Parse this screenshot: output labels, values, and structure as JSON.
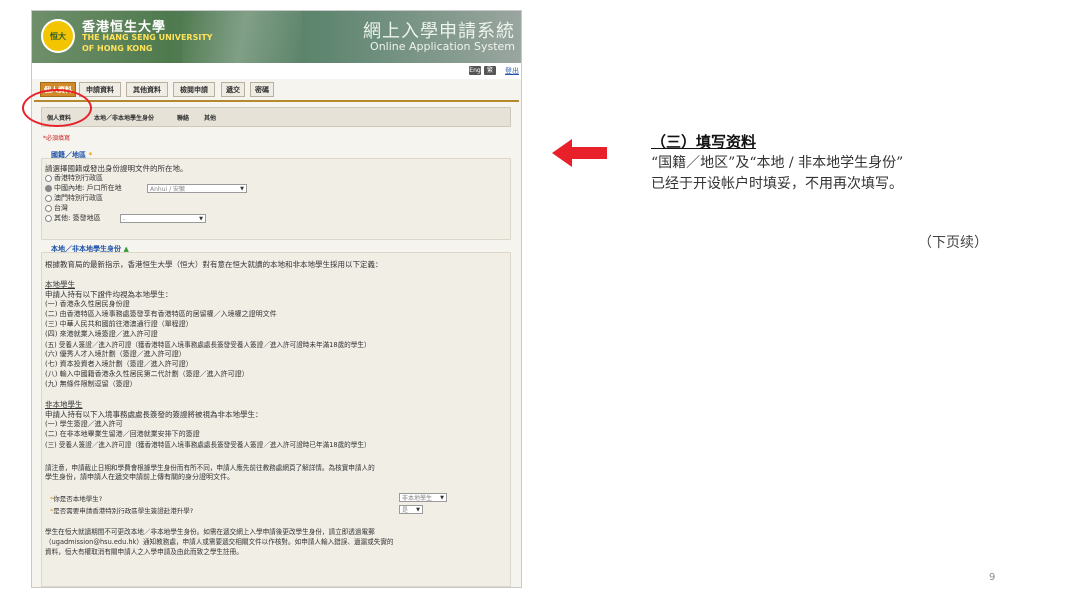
{
  "header": {
    "logo_text": "恒大",
    "university_zh": "香港恒生大學",
    "university_en_line1": "THE HANG SENG UNIVERSITY",
    "university_en_line2": "OF HONG KONG",
    "system_zh": "網上入學申請系統",
    "system_en": "Online Application System",
    "toolbar_btn1": "Eng",
    "toolbar_btn2": "繁",
    "toolbar_link": "登出"
  },
  "tabs": [
    "個人資料",
    "申請資料",
    "其他資料",
    "檢閱申請",
    "遞交",
    "密碼"
  ],
  "subnav": [
    "個人資料",
    "本地／非本地學生身份",
    "聯絡",
    "其他"
  ],
  "required_note": "*必須填寫",
  "nationality": {
    "title": "國籍／地區",
    "star": "*",
    "prompt": "請選擇國籍或發出身份證明文件的所在地。",
    "options": [
      "香港特別行政區",
      "中國內地: 戶口所在地",
      "澳門特別行政區",
      "台灣",
      "其他: 簽發地區"
    ],
    "province_value": "Anhui / 安徽",
    "other_value": "-"
  },
  "student_status": {
    "title": "本地／非本地學生身份",
    "intro": "根據教育局的最新指示，香港恒生大學（恒大）對有意在恒大就讀的本地和非本地學生採用以下定義：",
    "local_heading": "本地學生",
    "local_lead": "申請人持有以下證件均視為本地學生：",
    "local_items": [
      "(一) 香港永久性居民身份證",
      "(二) 由香港特區入境事務處簽發享有香港特區的居留權／入境權之證明文件",
      "(三) 中華人民共和國前往港澳通行證（單程證）",
      "(四) 來港就業入境簽證／進入許可證",
      "(五) 受養人簽證／進入許可證（獲香港特區入境事務處處長簽發受養人簽證／進入許可證時未年滿18歲的學生）",
      "(六) 優秀人才入境計劃（簽證／進入許可證）",
      "(七) 資本投資者入境計劃（簽證／進入許可證）",
      "(八) 輸入中國籍香港永久性居民第二代計劃（簽證／進入許可證）",
      "(九) 無條件限制逗留（簽證）"
    ],
    "nonlocal_heading": "非本地學生",
    "nonlocal_lead": "申請人持有以下入境事務處處長簽發的簽證將被視為非本地學生：",
    "nonlocal_items": [
      "(一) 學生簽證／進入許可",
      "(二) 在非本地畢業生留港／回港就業安排下的簽證",
      "(三) 受養人簽證／進入許可證（獲香港特區入境事務處處長簽發受養人簽證／進入許可證時已年滿18歲的學生）"
    ],
    "notice_line1": "請注意，申請截止日期和學費會根據學生身份而有所不同，申請人應先前往教務處網頁了解詳情。為核實申請人的",
    "notice_line2": "學生身份，請申請人在遞交申請前上傳有關的身分證明文件。",
    "q1": "你是否本地學生?",
    "q1_value": "非本地學生",
    "q2": "是否需要申請香港特別行政區學生簽證赴港升學?",
    "q2_value": "是",
    "footer_line1": "學生在恒大就讀期間不可更改本地／非本地學生身份。如需在遞交網上入學申請後更改學生身份，請立即透過電郵",
    "footer_line2": "（ugadmission@hsu.edu.hk）通知教務處，申請人或需要遞交相關文件以作核對。如申請人輸入錯誤、遺漏或失實的",
    "footer_line3": "資料，恒大有權取消有關申請人之入學申請及由此而致之學生註冊。"
  },
  "annotation": {
    "title": "（三）填写资料",
    "line1": "“国籍／地区”及“本地 / 非本地学生身份”",
    "line2": "已经于开设帐户时填妥，不用再次填写。",
    "continued": "（下页续）"
  },
  "page_number": "9",
  "colors": {
    "arrow": "#e8202a",
    "highlight_circle": "#e8202a",
    "active_tab": "#d18a2a",
    "section_title": "#2255aa"
  }
}
